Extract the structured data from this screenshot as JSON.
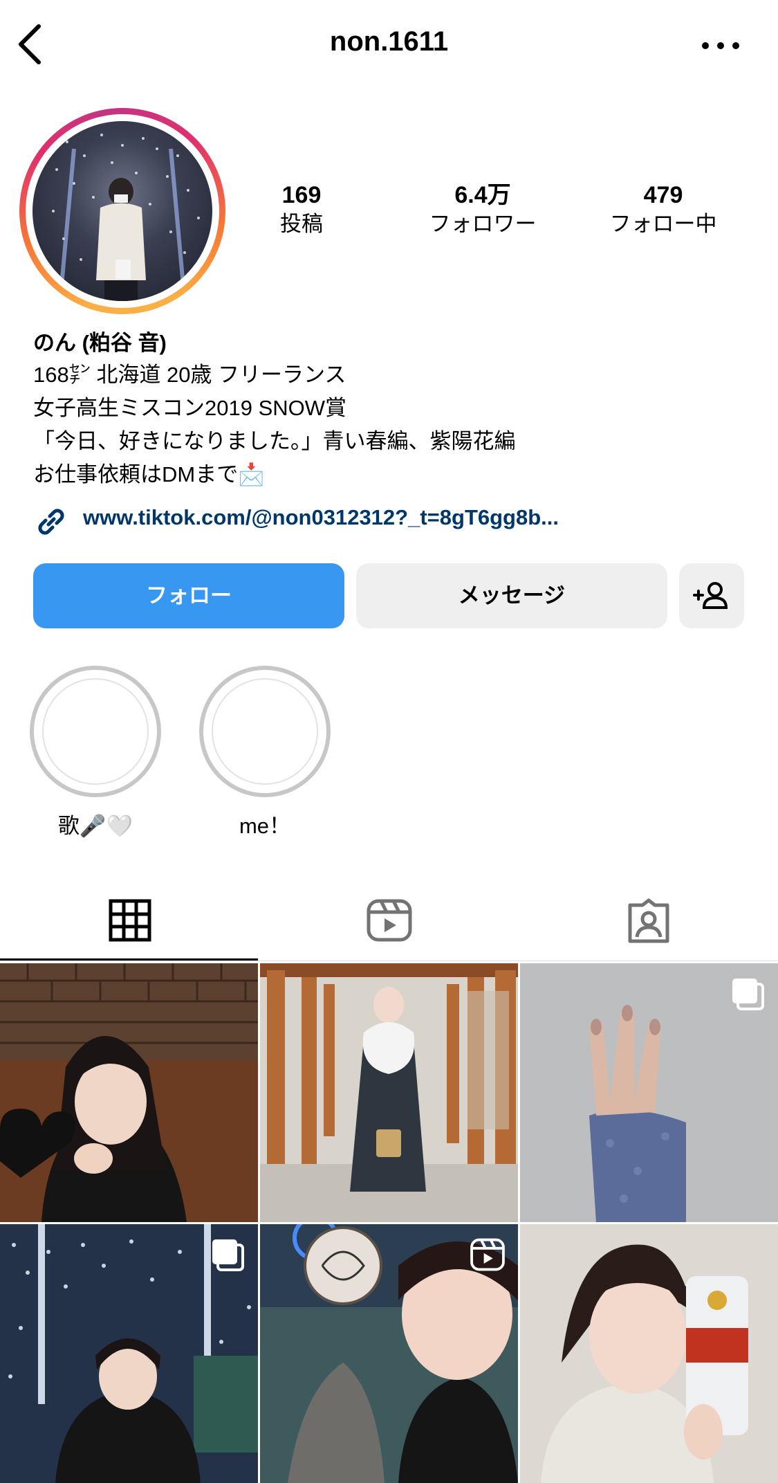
{
  "header": {
    "username": "non.1611",
    "back_icon": "chevron-left-icon",
    "more_icon": "ellipsis-icon"
  },
  "profile": {
    "stats": [
      {
        "value": "169",
        "label": "投稿"
      },
      {
        "value": "6.4万",
        "label": "フォロワー"
      },
      {
        "value": "479",
        "label": "フォロー中"
      }
    ],
    "display_name": "のん (粕谷 音)",
    "bio_lines": [
      "168㌢ 北海道 20歳 フリーランス",
      "女子高生ミスコン2019 SNOW賞",
      "「今日、好きになりました。」青い春編、紫陽花編",
      "お仕事依頼はDMまで📩"
    ],
    "link": "www.tiktok.com/@non0312312?_t=8gT6gg8b..."
  },
  "actions": {
    "follow": "フォロー",
    "message": "メッセージ",
    "add_user_icon": "add-user-icon"
  },
  "highlights": [
    {
      "label": "歌🎤🤍"
    },
    {
      "label": "me！"
    }
  ],
  "tabs": [
    {
      "icon": "grid-icon",
      "active": true
    },
    {
      "icon": "reels-icon",
      "active": false
    },
    {
      "icon": "tagged-icon",
      "active": false
    }
  ],
  "posts": [
    {
      "badge": null,
      "decoration": "black-heart"
    },
    {
      "badge": null
    },
    {
      "badge": "carousel-icon"
    },
    {
      "badge": "carousel-icon"
    },
    {
      "badge": "reels-icon"
    },
    {
      "badge": null
    }
  ],
  "colors": {
    "follow_button": "#3897f0",
    "link": "#00376b",
    "secondary_button": "#efefef"
  }
}
